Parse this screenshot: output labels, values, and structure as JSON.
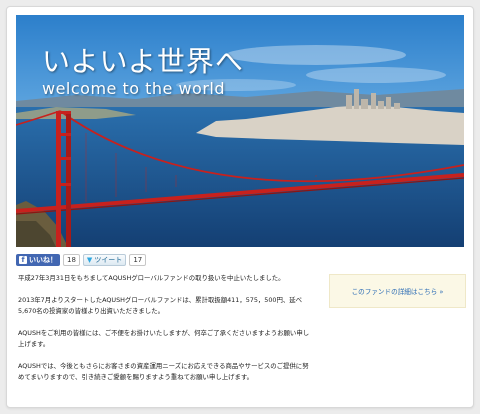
{
  "hero": {
    "title": "いよいよ世界へ",
    "subtitle": "welcome to the world"
  },
  "social": {
    "like_label": "いいね！",
    "like_count": "18",
    "tweet_label": "ツイート",
    "tweet_count": "17"
  },
  "content": {
    "paragraphs": [
      "平成27年3月31日をもちましてAQUSHグローバルファンドの取り扱いを中止いたしました。",
      "2013年7月よりスタートしたAQUSHグローバルファンドは、累計取扱額411，575，500円、延べ5,670名の投資家の皆様より出資いただきました。",
      "AQUSHをご利用の皆様には、ご不便をお掛けいたしますが、何卒ご了承くださいますようお願い申し上げます。",
      "AQUSHでは、今後ともさらにお客さまの資産運用ニーズにお応えできる商品やサービスのご提供に努めてまいりますので、引き続きご愛顧を賜りますよう重ねてお願い申し上げます。"
    ]
  },
  "sidebar": {
    "detail_link": "このファンドの詳細はこちら »"
  },
  "colors": {
    "bridge": "#d0231f",
    "sky_top": "#2f86cf",
    "water": "#1d5d9b",
    "link": "#2b6cb5",
    "detail_bg": "#fbf8e6"
  }
}
